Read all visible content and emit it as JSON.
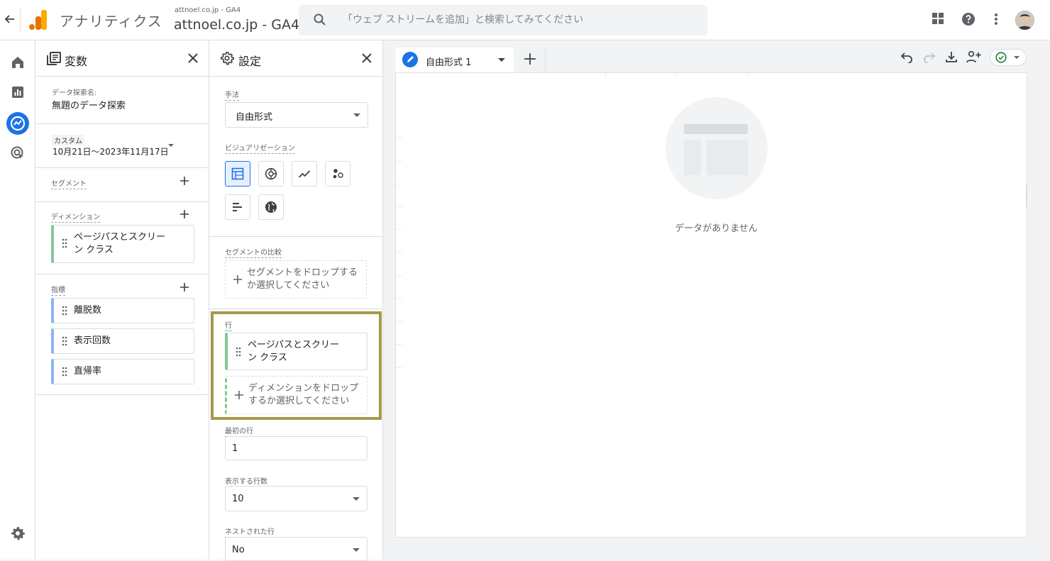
{
  "header": {
    "app_name": "アナリティクス",
    "account_small": "attnoel.co.jp - GA4",
    "account_big": "attnoel.co.jp - GA4",
    "search_placeholder": "「ウェブ ストリームを追加」と検索してみてください"
  },
  "variables_panel": {
    "title": "変数",
    "exploration_name_label": "データ探索名:",
    "exploration_name": "無題のデータ探索",
    "date_badge": "カスタム",
    "date_range": "10月21日～2023年11月17日",
    "segments_label": "セグメント",
    "dimensions_label": "ディメンション",
    "dimensions": [
      {
        "line1": "ページパスとスクリー",
        "line2": "ン クラス"
      }
    ],
    "metrics_label": "指標",
    "metrics": [
      "離脱数",
      "表示回数",
      "直帰率"
    ]
  },
  "settings_panel": {
    "title": "設定",
    "technique_label": "手法",
    "technique_value": "自由形式",
    "visualization_label": "ビジュアリゼーション",
    "segment_compare_label": "セグメントの比較",
    "segment_drop_line1": "セグメントをドロップする",
    "segment_drop_line2": "か選択してください",
    "rows_label": "行",
    "row_chip_line1": "ページパスとスクリー",
    "row_chip_line2": "ン クラス",
    "dim_drop_line1": "ディメンションをドロップ",
    "dim_drop_line2": "するか選択してください",
    "first_row_label": "最初の行",
    "first_row_value": "1",
    "rows_shown_label": "表示する行数",
    "rows_shown_value": "10",
    "nested_rows_label": "ネストされた行",
    "nested_rows_value": "No"
  },
  "canvas": {
    "tab_label": "自由形式 1",
    "empty_text": "データがありません"
  },
  "colors": {
    "accent": "#1a73e8",
    "highlight_border": "#a8994a",
    "dimension_chip": "#81c995",
    "metric_chip": "#8ab4f8"
  }
}
